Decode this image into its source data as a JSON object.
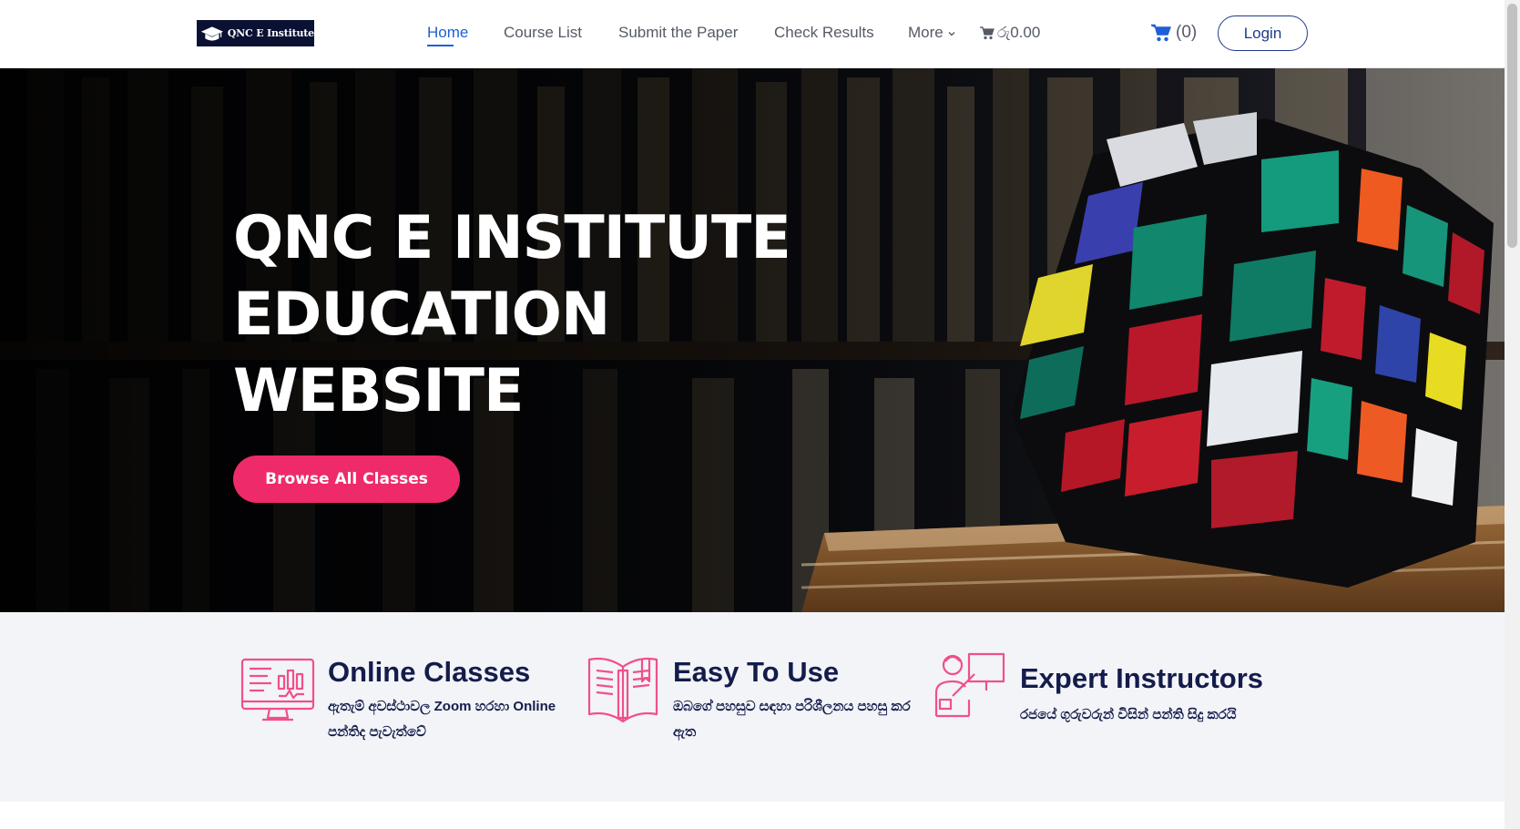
{
  "header": {
    "logo_text": "QNC E Institute",
    "nav": {
      "home": "Home",
      "course_list": "Course List",
      "submit_paper": "Submit the Paper",
      "check_results": "Check Results",
      "more": "More"
    },
    "mini_cart_amount": "රු0.00",
    "cart_count": "(0)",
    "login_label": "Login"
  },
  "hero": {
    "title_line1": "QNC E INSTITUTE",
    "title_line2": "EDUCATION",
    "title_line3": "WEBSITE",
    "button_label": "Browse All Classes"
  },
  "features": [
    {
      "title": "Online Classes",
      "desc_line1": "ඇතැම් අවස්ථාවල Zoom හරහා Online",
      "desc_line2": "පන්තිද පැවැත්වේ",
      "icon": "monitor-chart-icon"
    },
    {
      "title": "Easy To Use",
      "desc_line1": "ඔබගේ පහසුව සඳහා පරිශීලනය පහසු කර",
      "desc_line2": "ඇත",
      "icon": "open-book-icon"
    },
    {
      "title": "Expert Instructors",
      "desc_line1": "රජයේ ගුරුවරුන් විසින් පන්ති සිදු කරයි",
      "icon": "teacher-board-icon"
    }
  ],
  "colors": {
    "accent_blue": "#1f5fd6",
    "brand_navy": "#141c4c",
    "cta_pink": "#ee2a6a",
    "icon_pink": "#f0508a"
  }
}
